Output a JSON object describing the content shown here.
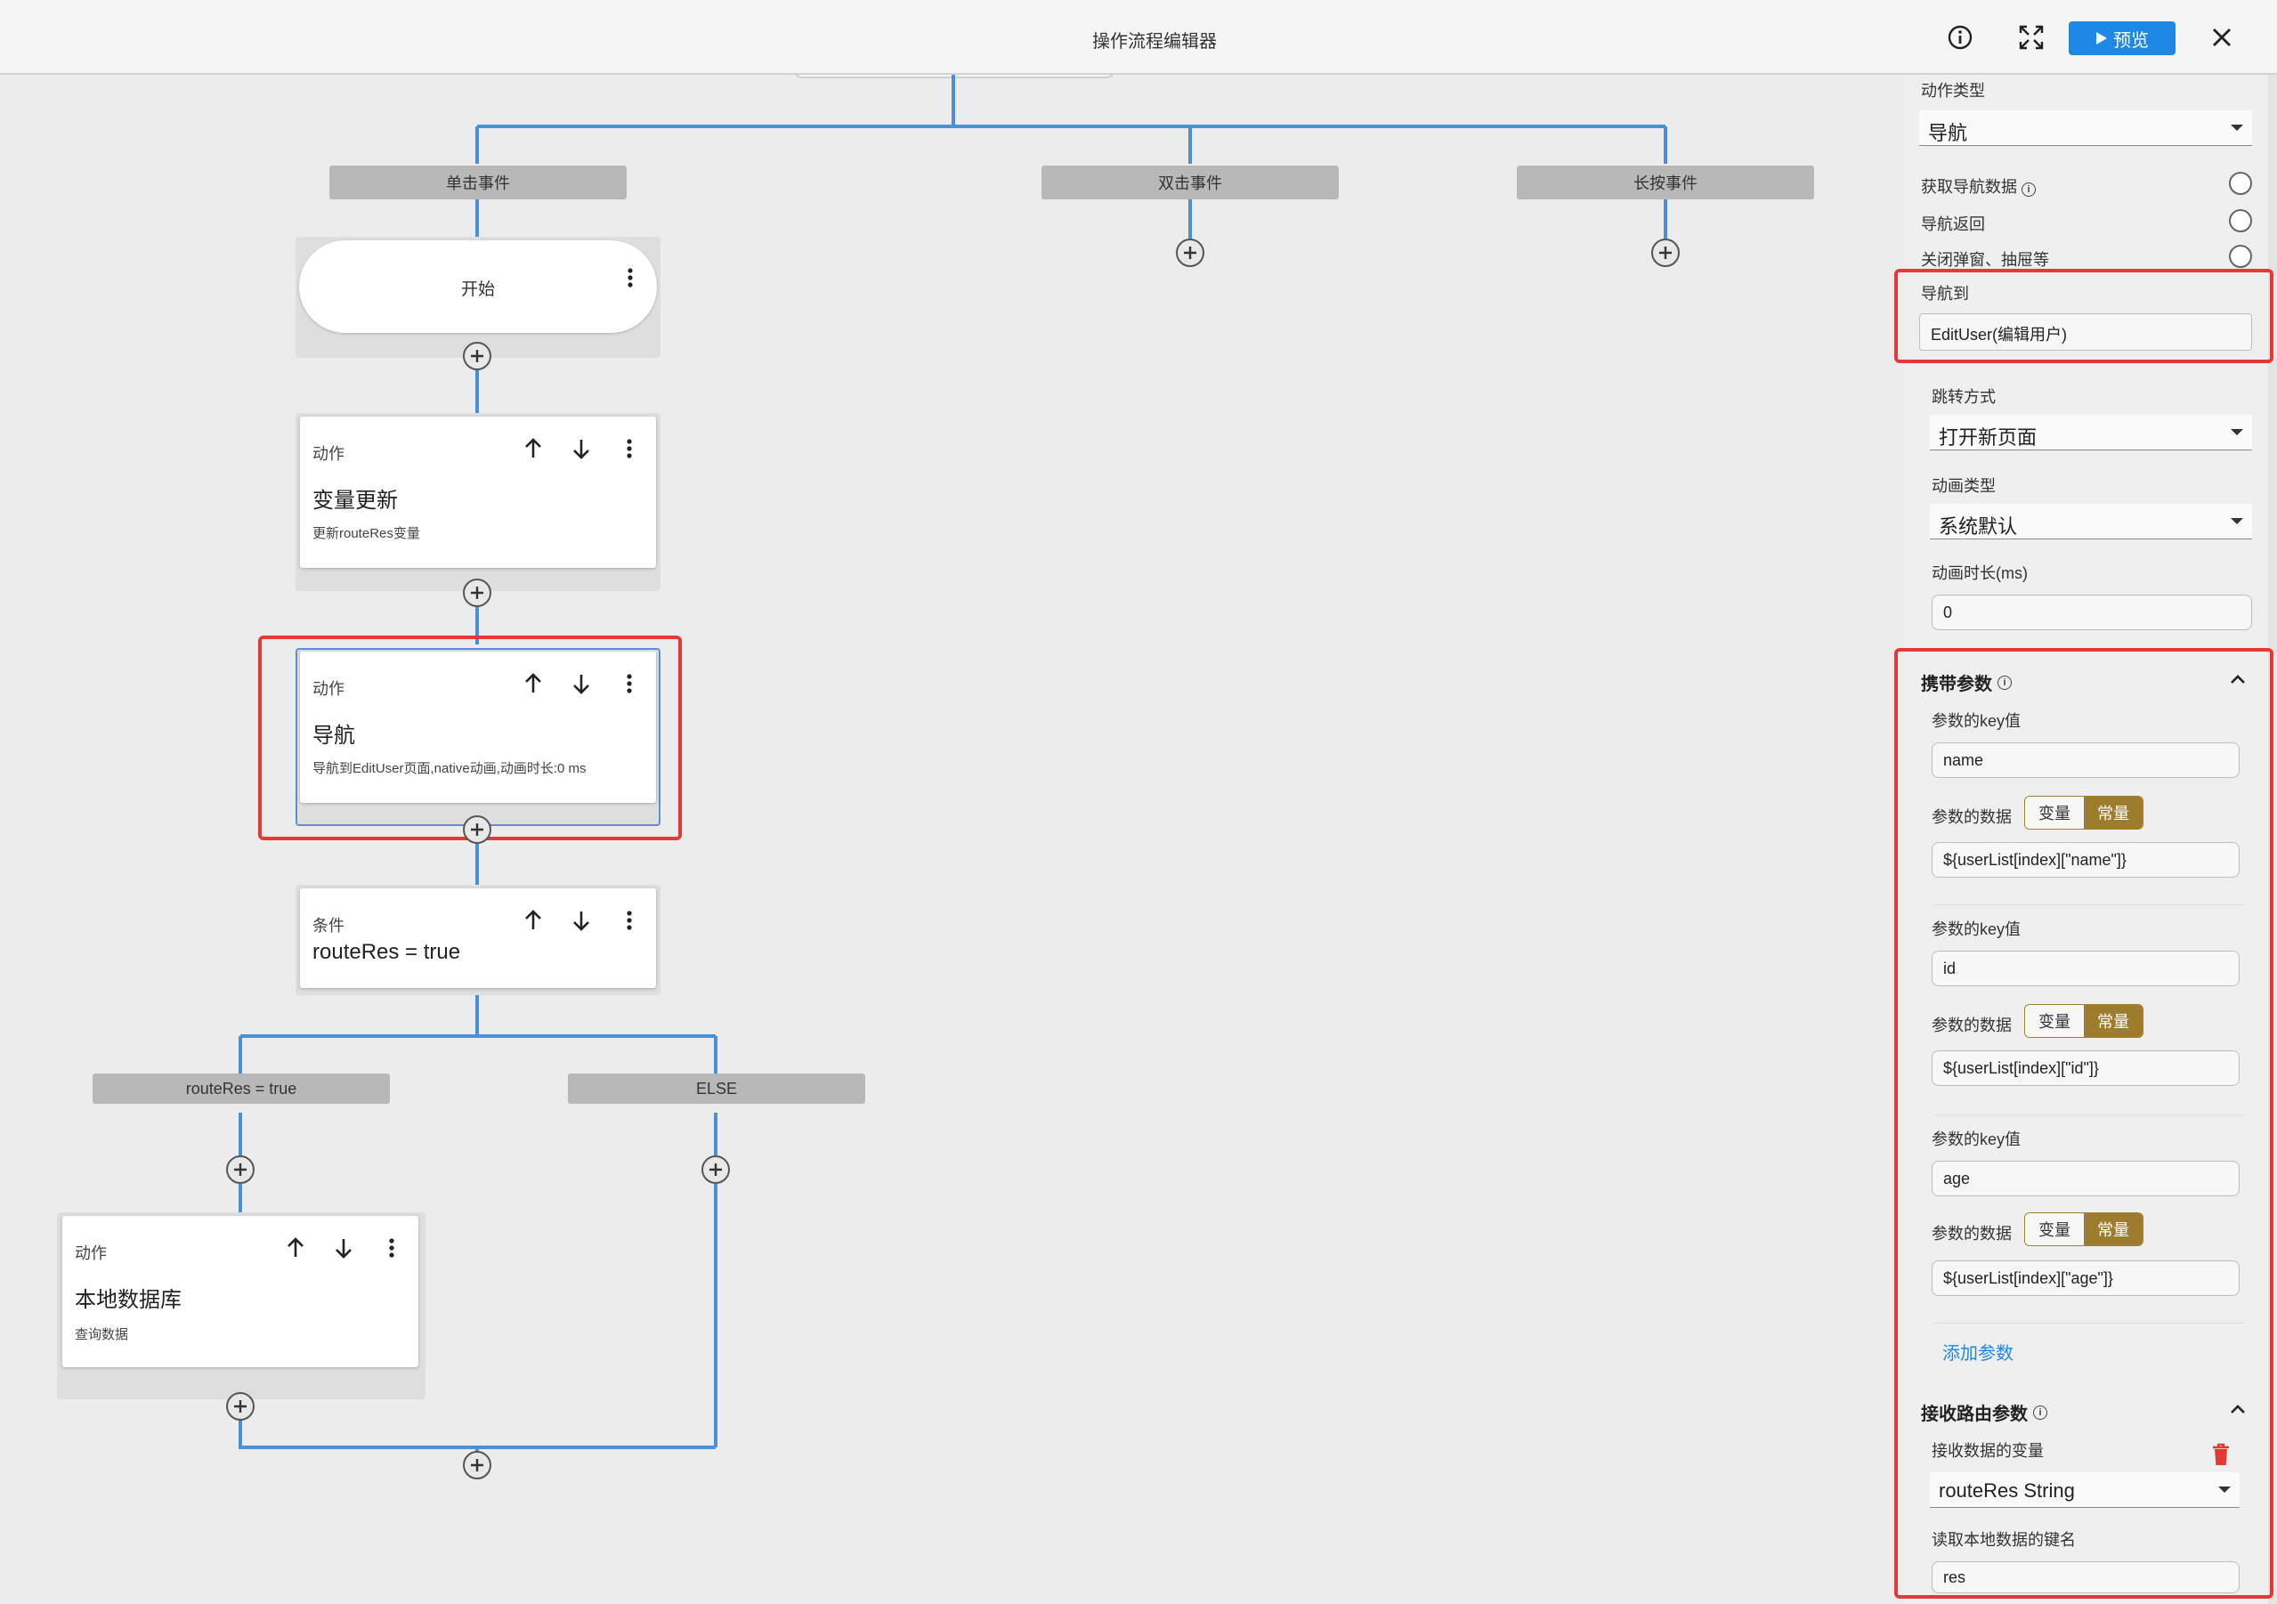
{
  "header": {
    "title": "操作流程编辑器",
    "preview_label": "预览"
  },
  "colors": {
    "line": "#4a90d9",
    "accent": "#1e88e5",
    "highlight": "#e53935",
    "segment_active": "#9e7c2e"
  },
  "events": {
    "click": "单击事件",
    "double": "双击事件",
    "long": "长按事件"
  },
  "start_label": "开始",
  "nodes": {
    "update": {
      "type": "动作",
      "title": "变量更新",
      "desc": "更新routeRes变量"
    },
    "nav": {
      "type": "动作",
      "title": "导航",
      "desc": "导航到EditUser页面,native动画,动画时长:0 ms"
    },
    "cond": {
      "type": "条件",
      "title": "routeRes = true"
    },
    "db": {
      "type": "动作",
      "title": "本地数据库",
      "desc": "查询数据"
    }
  },
  "branches": {
    "true_label": "routeRes = true",
    "else_label": "ELSE"
  },
  "panel": {
    "action_type_label": "动作类型",
    "action_type_value": "导航",
    "radio_get_nav_data": "获取导航数据",
    "radio_nav_back": "导航返回",
    "radio_close_popup": "关闭弹窗、抽屉等",
    "nav_to_label": "导航到",
    "nav_to_value": "EditUser(编辑用户)",
    "jump_mode_label": "跳转方式",
    "jump_mode_value": "打开新页面",
    "anim_type_label": "动画类型",
    "anim_type_value": "系统默认",
    "anim_duration_label": "动画时长(ms)",
    "anim_duration_value": "0",
    "params_title": "携带参数",
    "params": [
      {
        "key_label": "参数的key值",
        "key": "name",
        "data_label": "参数的数据",
        "data": "${userList[index][\"name\"]}"
      },
      {
        "key_label": "参数的key值",
        "key": "id",
        "data_label": "参数的数据",
        "data": "${userList[index][\"id\"]}"
      },
      {
        "key_label": "参数的key值",
        "key": "age",
        "data_label": "参数的数据",
        "data": "${userList[index][\"age\"]}"
      }
    ],
    "seg_variable": "变量",
    "seg_constant": "常量",
    "add_param": "添加参数",
    "receive_title": "接收路由参数",
    "receive_var_label": "接收数据的变量",
    "receive_var_value": "routeRes String",
    "local_key_label": "读取本地数据的键名",
    "local_key_value": "res"
  }
}
